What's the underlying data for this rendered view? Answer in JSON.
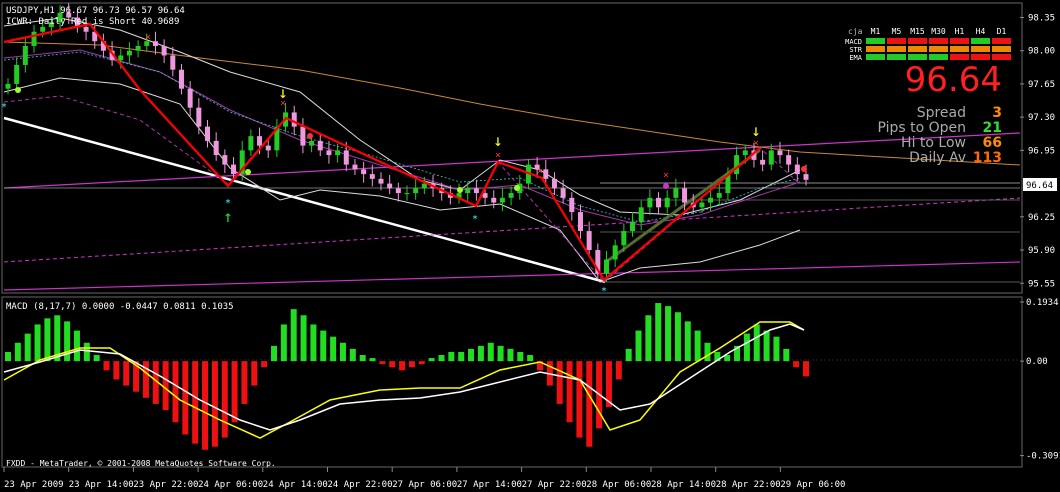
{
  "header": {
    "symbol_line": "USDJPY,H1  96.67 96.73 96.57 96.64",
    "indicator_line": "ICWR: Daily Red is Short 40.9689"
  },
  "info_panel": {
    "title": "cja",
    "columns": [
      "M1",
      "M5",
      "M15",
      "M30",
      "H1",
      "H4",
      "D1"
    ],
    "rows": [
      {
        "name": "MACD",
        "cells": [
          "green",
          "red",
          "red",
          "red",
          "red",
          "green",
          "red"
        ]
      },
      {
        "name": "STR",
        "cells": [
          "orange",
          "orange",
          "orange",
          "orange",
          "orange",
          "orange",
          "orange"
        ]
      },
      {
        "name": "EMA",
        "cells": [
          "green",
          "green",
          "green",
          "green",
          "red",
          "red",
          "red"
        ]
      }
    ],
    "big_price": "96.64",
    "stats": [
      {
        "label": "Spread",
        "value": "3",
        "color": "#ff8c00"
      },
      {
        "label": "Pips to Open",
        "value": "21",
        "color": "#33dd33"
      },
      {
        "label": "Hi to Low",
        "value": "66",
        "color": "#ff8c00"
      },
      {
        "label": "Daily Av",
        "value": "113",
        "color": "#ff6a00"
      }
    ]
  },
  "price_axis": {
    "ticks": [
      "98.35",
      "98.00",
      "97.65",
      "97.30",
      "96.95",
      "96.64",
      "96.25",
      "95.90",
      "95.55"
    ],
    "current": "96.64"
  },
  "macd_panel": {
    "label": "MACD  (8,17,7) 0.0000 -0.0447 0.0811 0.1035",
    "ticks": [
      "0.1934",
      "0.00",
      "-0.3091"
    ]
  },
  "footer": "FXDD - MetaTrader, © 2001-2008 MetaQuotes Software Corp.",
  "time_axis": [
    "23 Apr 2009",
    "23 Apr 14:00",
    "23 Apr 22:00",
    "24 Apr 06:00",
    "24 Apr 14:00",
    "24 Apr 22:00",
    "27 Apr 06:00",
    "27 Apr 14:00",
    "27 Apr 22:00",
    "28 Apr 06:00",
    "28 Apr 14:00",
    "28 Apr 22:00",
    "29 Apr 06:00"
  ],
  "colors": {
    "bg": "#000000",
    "bull_candle": "#22cc22",
    "bear_candle": "#ee99dd",
    "zigzag": "#ff0000",
    "white_trend": "#ffffff",
    "magenta": "#cc33cc",
    "orange_ma": "#cc8833",
    "macd_pos": "#22dd22",
    "macd_neg": "#ee1111",
    "macd_signal": "#ffff00",
    "macd_main": "#ffffff"
  },
  "chart_data": [
    {
      "type": "candlestick",
      "title": "USDJPY,H1",
      "close_series_approx": [
        97.65,
        97.85,
        98.05,
        98.2,
        98.25,
        98.3,
        98.4,
        98.35,
        98.25,
        98.2,
        98.1,
        98.0,
        97.9,
        97.95,
        98.0,
        98.05,
        98.1,
        98.05,
        97.95,
        97.8,
        97.6,
        97.4,
        97.2,
        97.05,
        96.9,
        96.8,
        96.7,
        96.95,
        97.1,
        97.0,
        96.95,
        97.2,
        97.35,
        97.2,
        97.0,
        97.05,
        96.95,
        96.9,
        96.95,
        96.8,
        96.75,
        96.7,
        96.65,
        96.6,
        96.55,
        96.5,
        96.5,
        96.55,
        96.6,
        96.55,
        96.5,
        96.45,
        96.5,
        96.55,
        96.5,
        96.45,
        96.4,
        96.45,
        96.5,
        96.6,
        96.8,
        96.75,
        96.65,
        96.55,
        96.45,
        96.3,
        96.1,
        95.9,
        95.65,
        95.8,
        95.95,
        96.1,
        96.2,
        96.35,
        96.45,
        96.35,
        96.45,
        96.55,
        96.4,
        96.35,
        96.4,
        96.45,
        96.5,
        96.7,
        96.9,
        96.95,
        96.85,
        96.8,
        96.95,
        96.9,
        96.8,
        96.7,
        96.64
      ],
      "y_range": [
        95.5,
        98.45
      ],
      "price_ticks": [
        98.35,
        98.0,
        97.65,
        97.3,
        96.95,
        96.64,
        96.25,
        95.9,
        95.55
      ],
      "current_price": 96.64
    },
    {
      "type": "bar",
      "title": "MACD (8,17,7)",
      "values_approx": [
        0.03,
        0.06,
        0.09,
        0.12,
        0.14,
        0.15,
        0.13,
        0.1,
        0.06,
        0.02,
        -0.03,
        -0.06,
        -0.08,
        -0.1,
        -0.12,
        -0.14,
        -0.16,
        -0.2,
        -0.24,
        -0.27,
        -0.29,
        -0.28,
        -0.25,
        -0.2,
        -0.14,
        -0.08,
        -0.02,
        0.05,
        0.12,
        0.17,
        0.15,
        0.12,
        0.1,
        0.08,
        0.06,
        0.04,
        0.02,
        0.01,
        -0.01,
        -0.02,
        -0.03,
        -0.02,
        -0.01,
        0.01,
        0.02,
        0.03,
        0.03,
        0.04,
        0.05,
        0.06,
        0.05,
        0.04,
        0.03,
        0.02,
        -0.03,
        -0.08,
        -0.14,
        -0.2,
        -0.25,
        -0.28,
        -0.22,
        -0.15,
        -0.06,
        0.04,
        0.1,
        0.15,
        0.19,
        0.18,
        0.16,
        0.13,
        0.1,
        0.06,
        0.03,
        0.02,
        0.05,
        0.09,
        0.12,
        0.1,
        0.08,
        0.04,
        -0.02,
        -0.05
      ],
      "ticks": [
        0.1934,
        0.0,
        -0.3091
      ],
      "y_range": [
        -0.33,
        0.2
      ]
    }
  ]
}
